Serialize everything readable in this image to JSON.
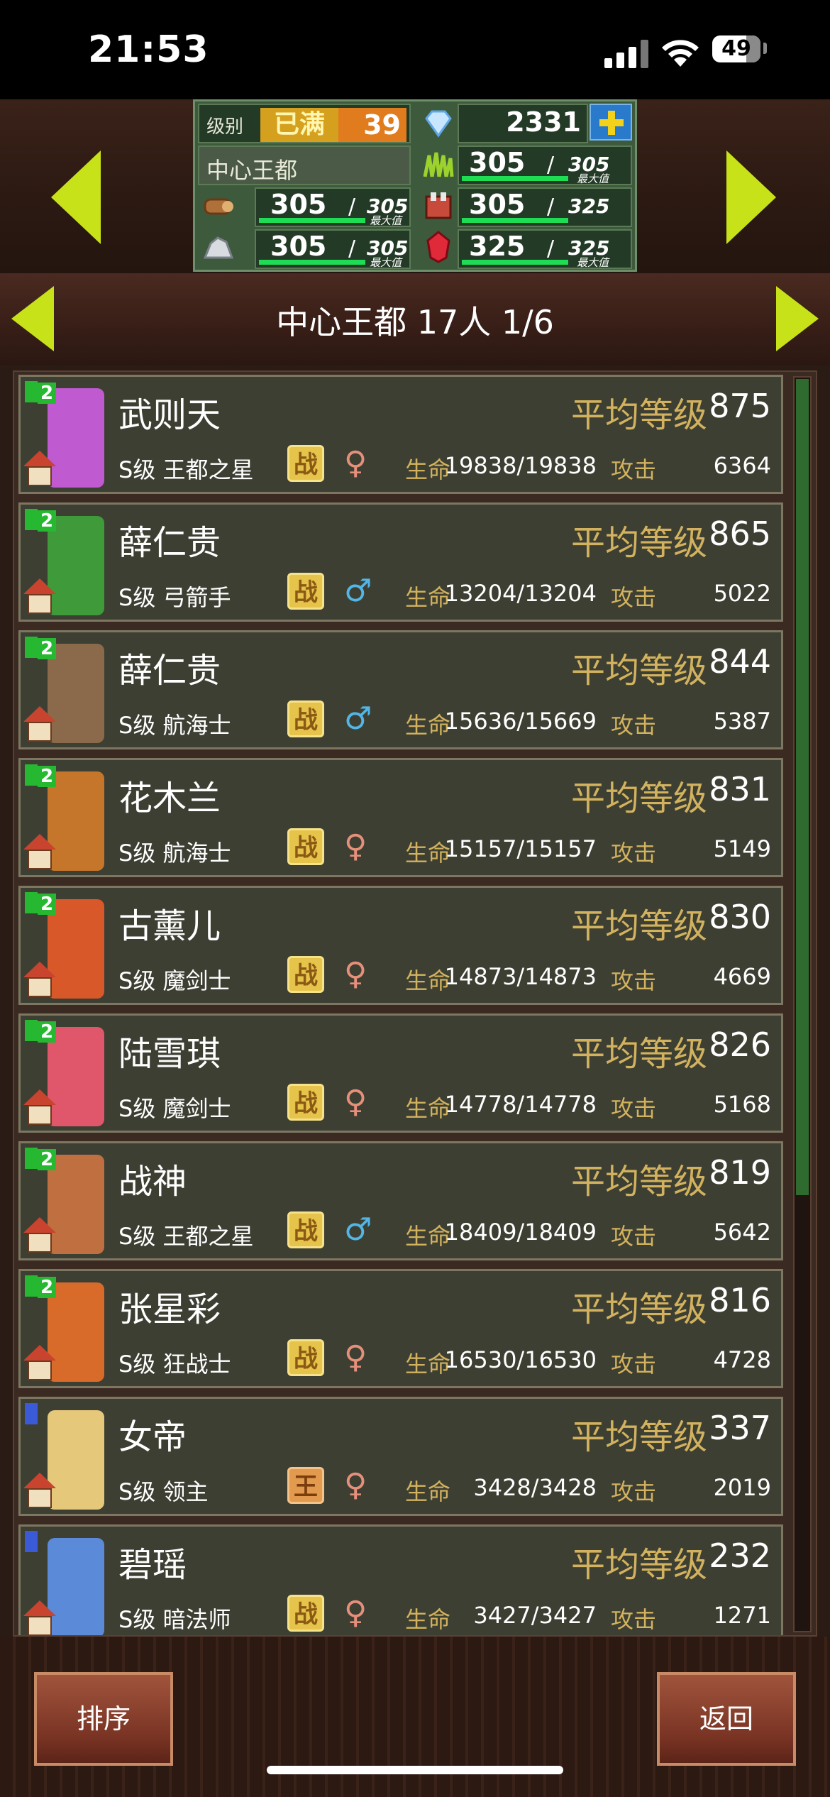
{
  "status_bar": {
    "time": "21:53",
    "battery": "49"
  },
  "resources": {
    "level_label": "级别",
    "level_status": "已满",
    "level_value": "39",
    "gems": "2331",
    "town_name": "中心王都",
    "rows": [
      {
        "icon": "grass-icon",
        "current": "305",
        "max": "305",
        "max_tag": "最大值"
      },
      {
        "icon": "wood-icon",
        "current": "305",
        "max": "305",
        "max_tag": "最大值"
      },
      {
        "icon": "food-icon",
        "current": "305",
        "max": "325"
      },
      {
        "icon": "ore-icon",
        "current": "305",
        "max": "305",
        "max_tag": "最大值"
      },
      {
        "icon": "ruby-icon",
        "current": "325",
        "max": "325",
        "max_tag": "最大值"
      }
    ]
  },
  "header": {
    "title": "中心王都  17人 1/6"
  },
  "labels": {
    "avg_level": "平均等级",
    "hp": "生命",
    "atk": "攻击"
  },
  "characters": [
    {
      "name": "武则天",
      "avg": "875",
      "cls": "S级 王都之星",
      "job": "战",
      "gender": "♀",
      "hp": "19838/19838",
      "atk": "6364",
      "rank": "2"
    },
    {
      "name": "薛仁贵",
      "avg": "865",
      "cls": "S级 弓箭手",
      "job": "战",
      "gender": "♂",
      "hp": "13204/13204",
      "atk": "5022",
      "rank": "2"
    },
    {
      "name": "薛仁贵",
      "avg": "844",
      "cls": "S级 航海士",
      "job": "战",
      "gender": "♂",
      "hp": "15636/15669",
      "atk": "5387",
      "rank": "2"
    },
    {
      "name": "花木兰",
      "avg": "831",
      "cls": "S级 航海士",
      "job": "战",
      "gender": "♀",
      "hp": "15157/15157",
      "atk": "5149",
      "rank": "2"
    },
    {
      "name": "古薰儿",
      "avg": "830",
      "cls": "S级 魔剑士",
      "job": "战",
      "gender": "♀",
      "hp": "14873/14873",
      "atk": "4669",
      "rank": "2"
    },
    {
      "name": "陆雪琪",
      "avg": "826",
      "cls": "S级 魔剑士",
      "job": "战",
      "gender": "♀",
      "hp": "14778/14778",
      "atk": "5168",
      "rank": "2"
    },
    {
      "name": "战神",
      "avg": "819",
      "cls": "S级 王都之星",
      "job": "战",
      "gender": "♂",
      "hp": "18409/18409",
      "atk": "5642",
      "rank": "2"
    },
    {
      "name": "张星彩",
      "avg": "816",
      "cls": "S级 狂战士",
      "job": "战",
      "gender": "♀",
      "hp": "16530/16530",
      "atk": "4728",
      "rank": "2"
    },
    {
      "name": "女帝",
      "avg": "337",
      "cls": "S级 领主",
      "job": "王",
      "gender": "♀",
      "hp": "3428/3428",
      "atk": "2019",
      "rank": ""
    },
    {
      "name": "碧瑶",
      "avg": "232",
      "cls": "S级 暗法师",
      "job": "战",
      "gender": "♀",
      "hp": "3427/3427",
      "atk": "1271",
      "rank": ""
    }
  ],
  "buttons": {
    "sort": "排序",
    "back": "返回"
  },
  "colors": {
    "accent_green": "#c8e21a",
    "label_gold": "#d2b25e",
    "row_bg": "#3d3f33"
  }
}
